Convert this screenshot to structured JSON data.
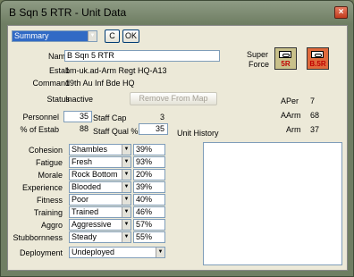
{
  "window": {
    "title": "B Sqn 5 RTR - Unit Data",
    "close_glyph": "×"
  },
  "toolbar": {
    "view_select": "Summary",
    "c_label": "C",
    "ok_label": "OK"
  },
  "unit": {
    "name_label": "Name",
    "name": "B Sqn 5 RTR",
    "estab_label": "Estab",
    "estab": "1m-uk.ad-Arm Regt HQ-A13",
    "command_label": "Command",
    "command": "19th Au Inf Bde HQ",
    "status_label": "Status",
    "status": "Inactive",
    "remove_label": "Remove From Map"
  },
  "force": {
    "super_label": "Super",
    "force_label": "Force",
    "chip1_value": "5R",
    "chip2_value": "B.5R",
    "chip1_color": "#c9c18a",
    "chip2_color": "#e06a3c"
  },
  "stats": {
    "personnel_label": "Personnel",
    "personnel": "35",
    "estab_pct_label": "% of Estab",
    "estab_pct": "88",
    "staff_cap_label": "Staff Cap",
    "staff_cap": "3",
    "staff_qual_label": "Staff Qual %",
    "staff_qual": "35",
    "aper_label": "APer",
    "aper": "7",
    "aarm_label": "AArm",
    "aarm": "68",
    "arm_label": "Arm",
    "arm": "37"
  },
  "history": {
    "label": "Unit History"
  },
  "attributes": [
    {
      "label": "Cohesion",
      "value": "Shambles",
      "pct": "39%"
    },
    {
      "label": "Fatigue",
      "value": "Fresh",
      "pct": "93%"
    },
    {
      "label": "Morale",
      "value": "Rock Bottom",
      "pct": "20%"
    },
    {
      "label": "Experience",
      "value": "Blooded",
      "pct": "39%"
    },
    {
      "label": "Fitness",
      "value": "Poor",
      "pct": "40%"
    },
    {
      "label": "Training",
      "value": "Trained",
      "pct": "46%"
    },
    {
      "label": "Aggro",
      "value": "Aggressive",
      "pct": "57%"
    },
    {
      "label": "Stubbornness",
      "value": "Steady",
      "pct": "55%"
    }
  ],
  "deployment": {
    "label": "Deployment",
    "value": "Undeployed"
  }
}
